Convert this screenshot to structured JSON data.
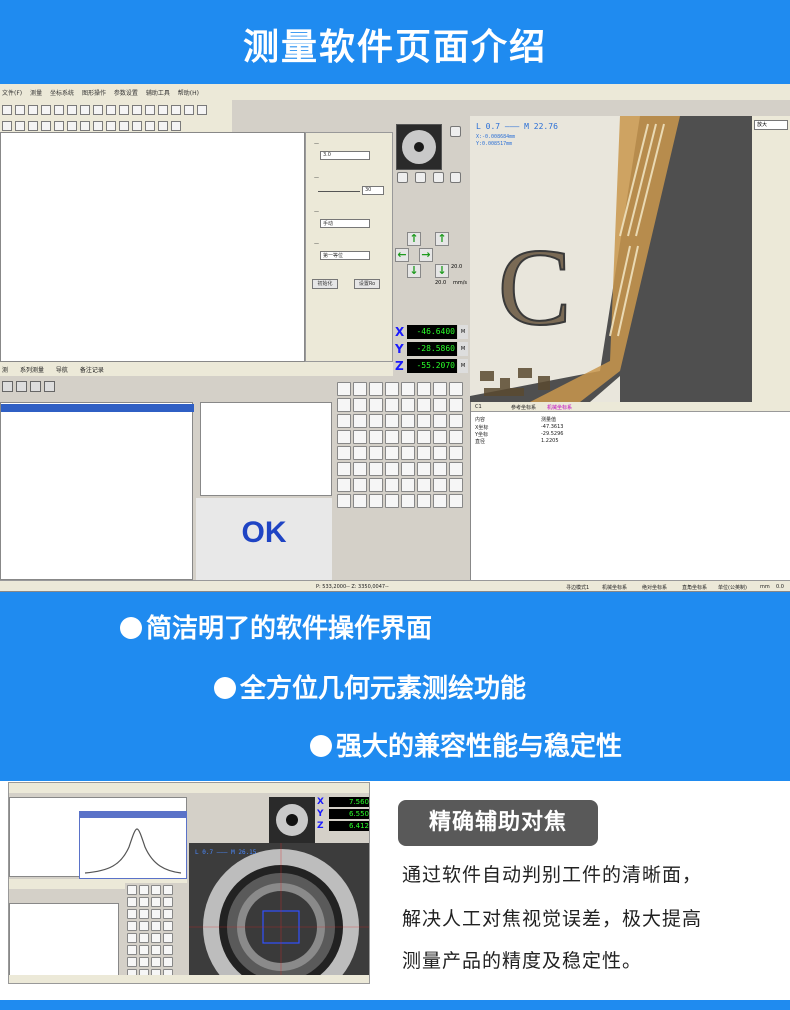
{
  "header": {
    "title": "测量软件页面介绍"
  },
  "colors": {
    "brand_blue": "#1f8bf0",
    "tag_gray": "#595959",
    "readout_green": "#2aff2a",
    "ok_blue": "#1f44c4"
  },
  "software": {
    "menu": [
      "文件(F)",
      "测量",
      "坐标系统",
      "图形操作",
      "参数设置",
      "辅助工具",
      "帮助(H)"
    ],
    "tabs": [
      "测",
      "系列测量",
      "导航",
      "备注记录"
    ],
    "camera": {
      "readout_main": "L 0.7 ——— M 22.76",
      "readout_x": "X:-0.008684mm",
      "readout_y": "Y:0.008517mm",
      "zoom_select": "放大"
    },
    "coords": [
      {
        "axis": "X",
        "value": "-46.6400",
        "unit": "M"
      },
      {
        "axis": "Y",
        "value": "-28.5860",
        "unit": "M"
      },
      {
        "axis": "Z",
        "value": "-55.2070",
        "unit": "M"
      }
    ],
    "params": {
      "sel1": "3.0",
      "slider_val": "30",
      "sel2": "手动",
      "sel3": "第一等位",
      "btn1": "初始化",
      "btn2": "设置Ro"
    },
    "speed": {
      "val1": "20.0",
      "val2": "20.0",
      "unit": "mm/s"
    },
    "result_header": {
      "col1": "C1",
      "col2": "参考坐标系",
      "col3": "机械坐标系"
    },
    "result_cols": [
      "内容",
      "测量值"
    ],
    "result_rows": [
      {
        "name": "X坐标",
        "value": "-47.3613"
      },
      {
        "name": "Y坐标",
        "value": "-29.5296"
      },
      {
        "name": "直径",
        "value": "1.2205"
      }
    ],
    "status_text": "P: 533,2000-- Z: 3350,0047--",
    "status_right": [
      "寻边模式1",
      "机械坐标系",
      "绝对坐标系",
      "直角坐标系",
      "单位(公英制)",
      "mm",
      "0.0"
    ],
    "result_label": "OK"
  },
  "features": [
    "简洁明了的软件操作界面",
    "全方位几何元素测绘功能",
    "强大的兼容性能与稳定性"
  ],
  "focus": {
    "tag": "精确辅助对焦",
    "desc_lines": [
      "通过软件自动判别工件的清晰面，",
      "解决人工对焦视觉误差，极大提高",
      "测量产品的精度及稳定性。"
    ],
    "coords": [
      {
        "axis": "X",
        "value": "7.560"
      },
      {
        "axis": "Y",
        "value": "6.550"
      },
      {
        "axis": "Z",
        "value": "6.412"
      }
    ],
    "readout": "L 0.7 ——— M 26.15"
  }
}
